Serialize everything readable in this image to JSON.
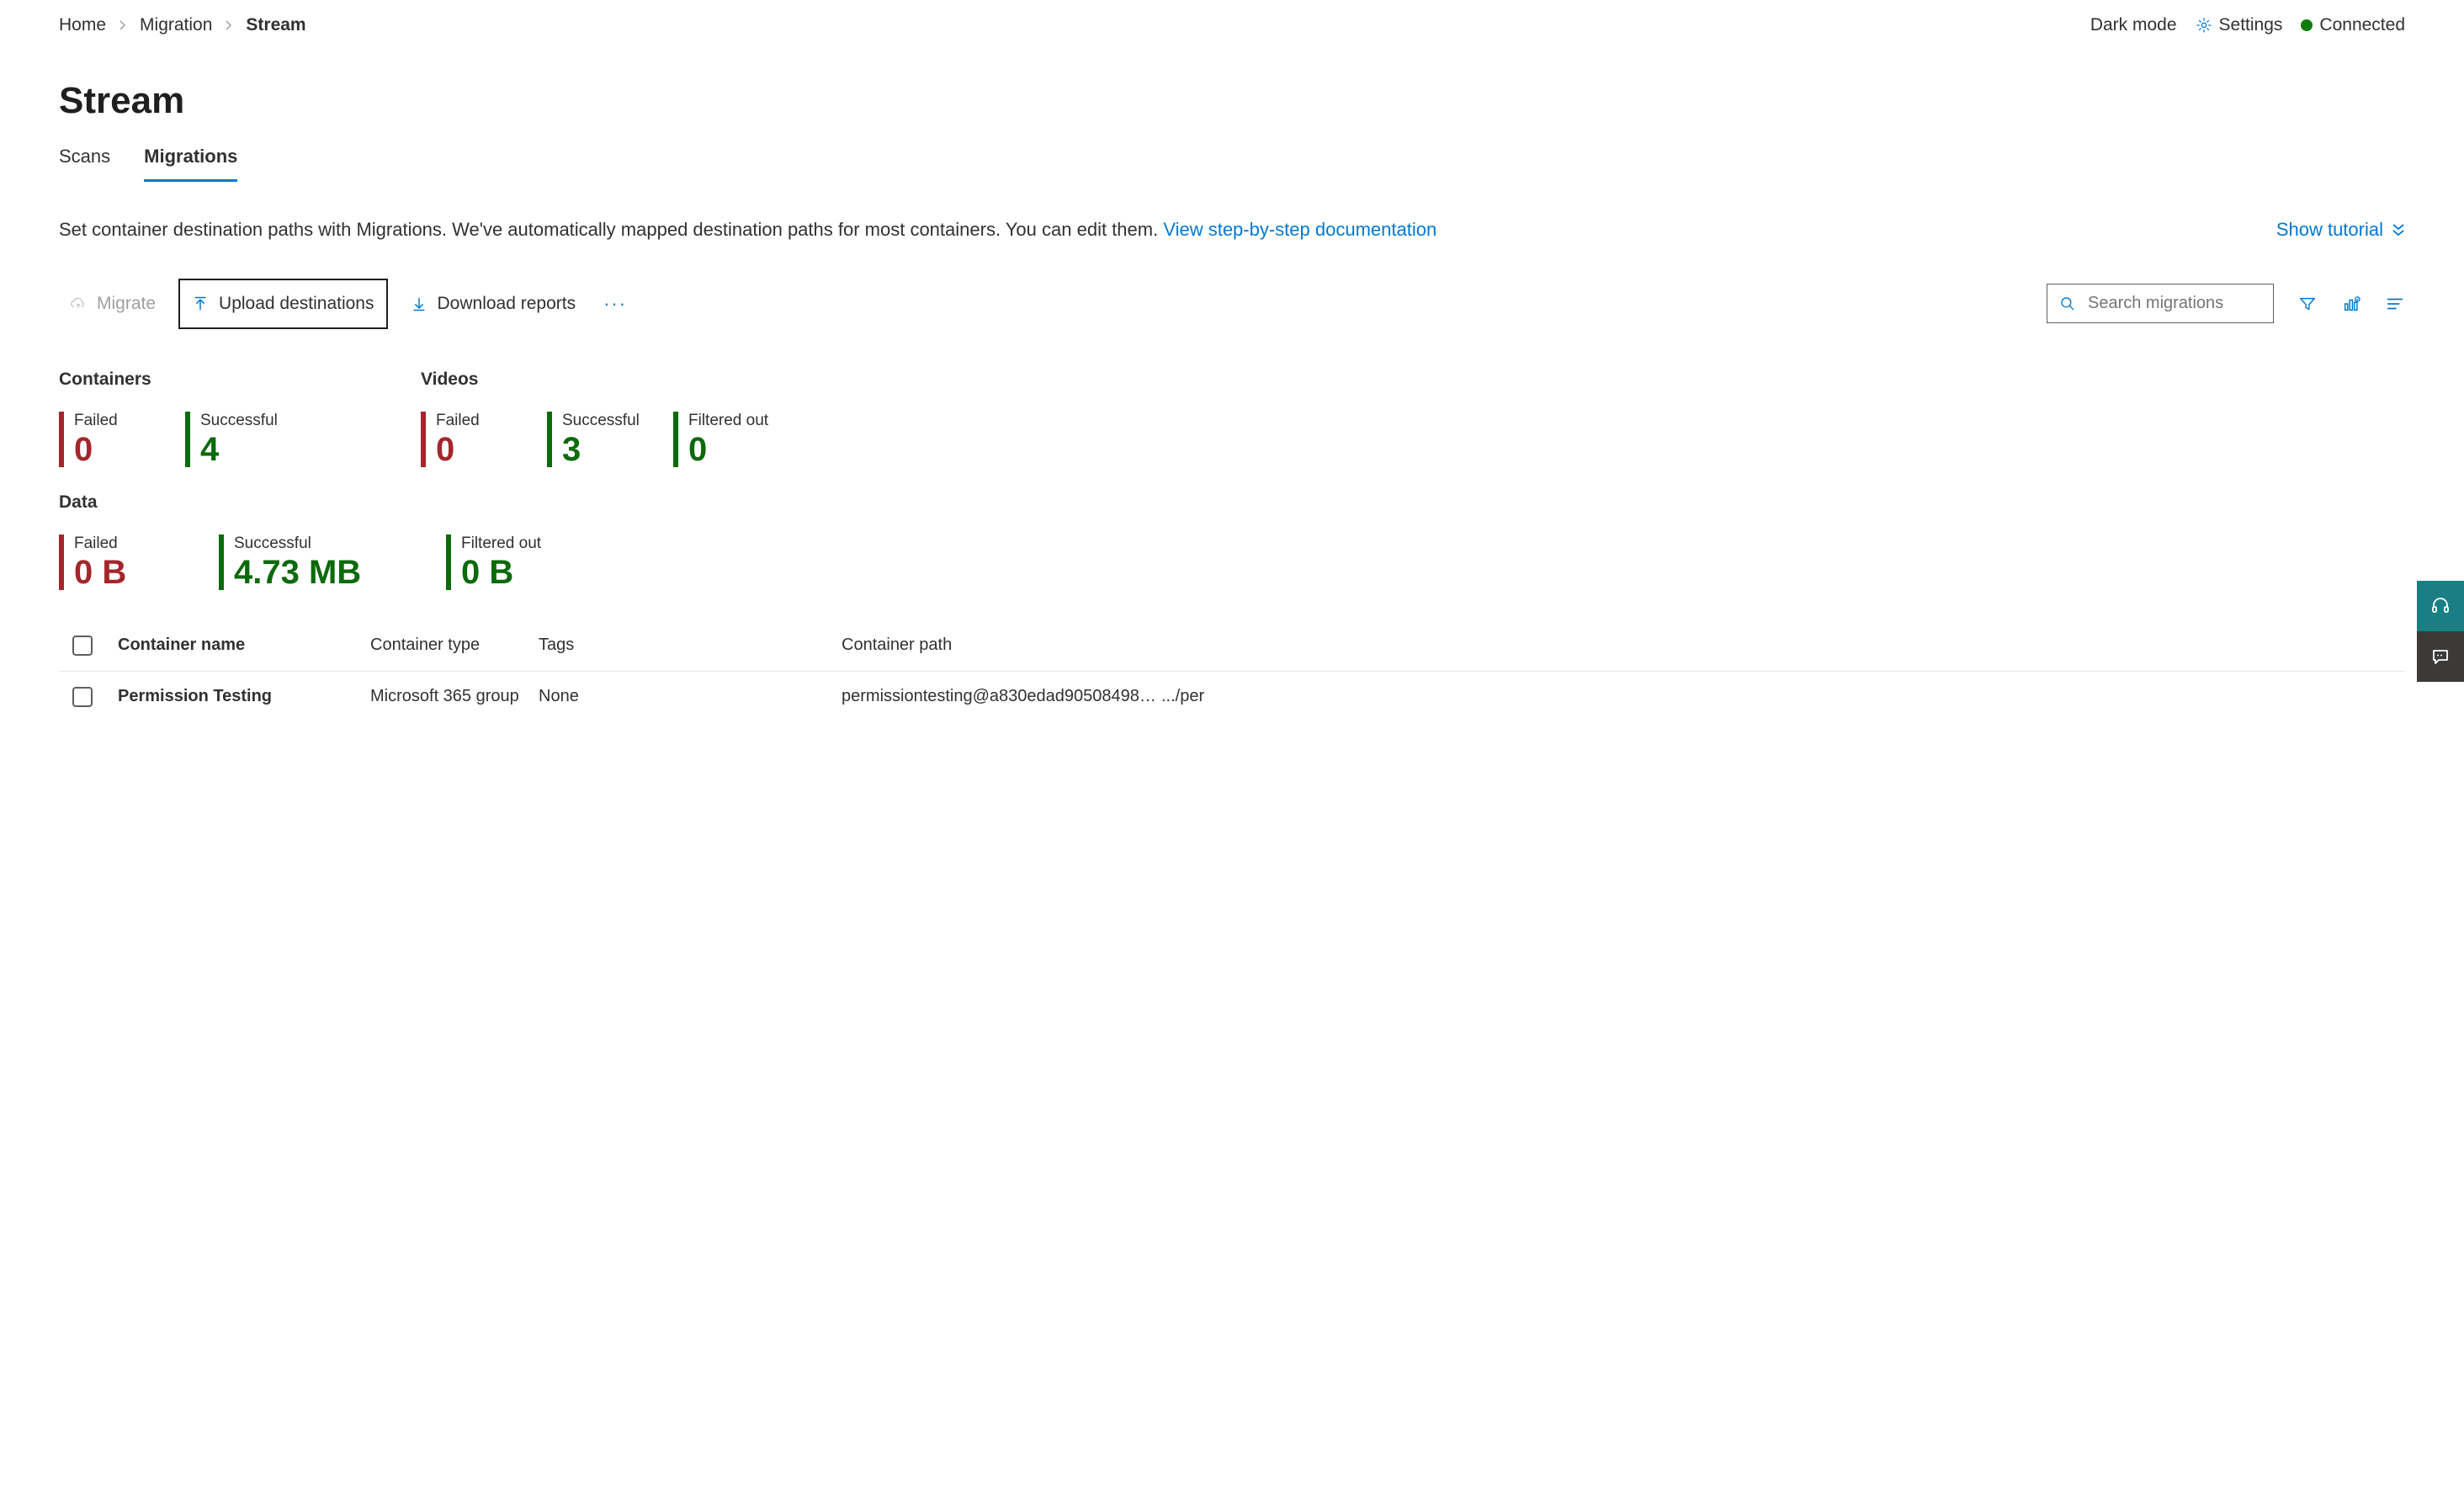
{
  "breadcrumb": {
    "items": [
      {
        "label": "Home"
      },
      {
        "label": "Migration"
      },
      {
        "label": "Stream"
      }
    ]
  },
  "header": {
    "dark_mode": "Dark mode",
    "settings": "Settings",
    "connected": "Connected"
  },
  "page_title": "Stream",
  "tabs": [
    {
      "label": "Scans",
      "active": false
    },
    {
      "label": "Migrations",
      "active": true
    }
  ],
  "description": {
    "text_before": "Set container destination paths with Migrations. We've automatically mapped destination paths for most containers. You can edit them. ",
    "link_label": "View step-by-step documentation",
    "show_tutorial": "Show tutorial"
  },
  "toolbar": {
    "migrate": "Migrate",
    "upload": "Upload destinations",
    "download": "Download reports",
    "search_placeholder": "Search migrations"
  },
  "stats": {
    "containers": {
      "title": "Containers",
      "failed_label": "Failed",
      "failed_value": "0",
      "success_label": "Successful",
      "success_value": "4"
    },
    "videos": {
      "title": "Videos",
      "failed_label": "Failed",
      "failed_value": "0",
      "success_label": "Successful",
      "success_value": "3",
      "filtered_label": "Filtered out",
      "filtered_value": "0"
    },
    "data": {
      "title": "Data",
      "failed_label": "Failed",
      "failed_value": "0 B",
      "success_label": "Successful",
      "success_value": "4.73 MB",
      "filtered_label": "Filtered out",
      "filtered_value": "0 B"
    }
  },
  "table": {
    "headers": {
      "name": "Container name",
      "type": "Container type",
      "tags": "Tags",
      "path": "Container path"
    },
    "rows": [
      {
        "name": "Permission Testing",
        "type": "Microsoft 365 group",
        "tags": "None",
        "path": "permissiontesting@a830edad905084988…",
        "extra": ".../per"
      }
    ]
  }
}
